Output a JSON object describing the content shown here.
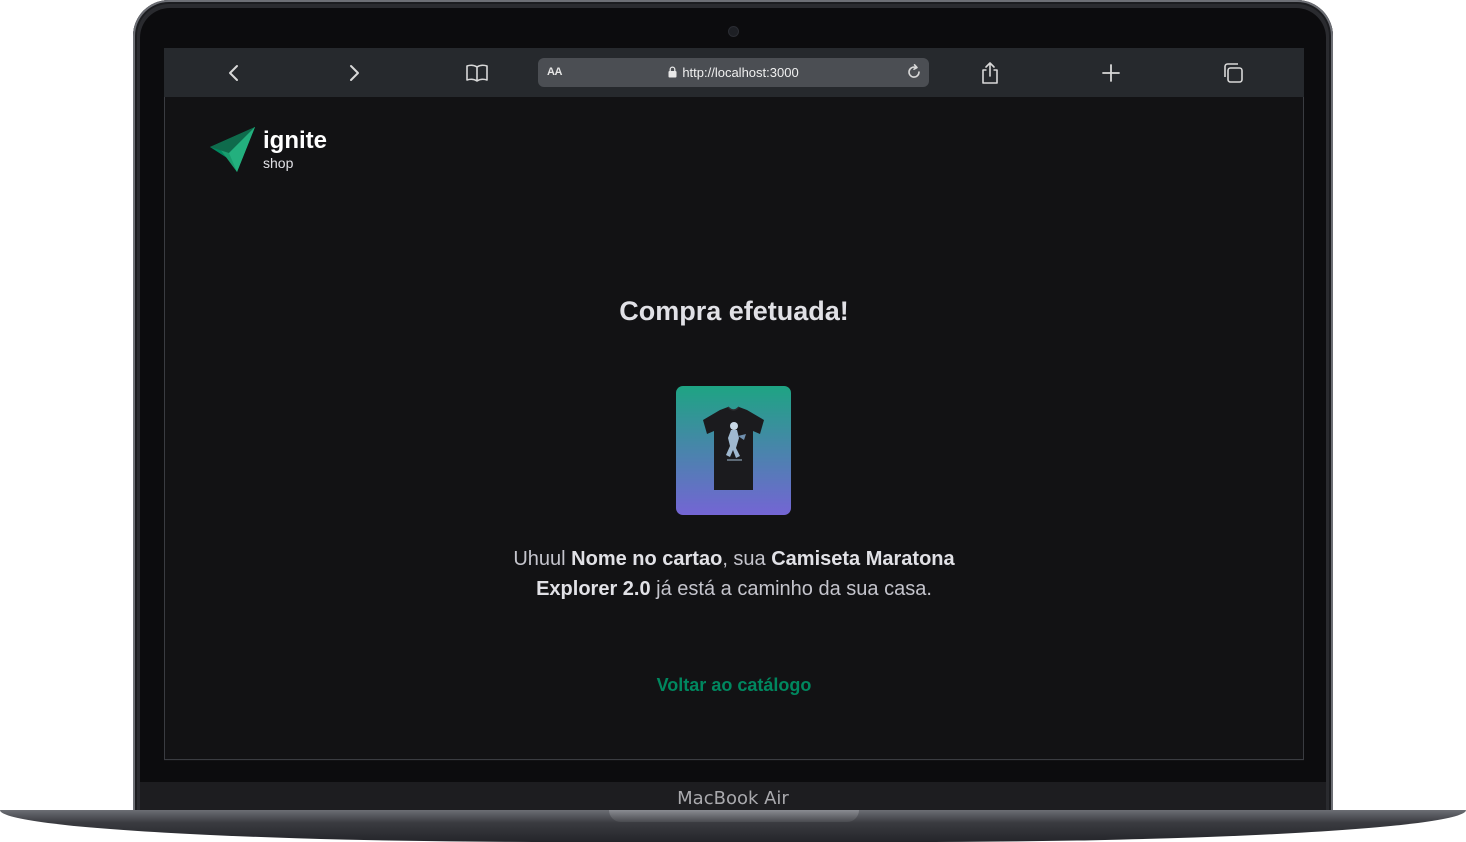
{
  "browser": {
    "url_aa": "AA",
    "url": "http://localhost:3000",
    "icons": [
      "back-icon",
      "forward-icon",
      "book-icon",
      "lock-icon",
      "reload-icon",
      "share-icon",
      "new-tab-icon",
      "tabs-icon"
    ]
  },
  "brand": {
    "title": "ignite",
    "subtitle": "shop",
    "accent": "#00875f"
  },
  "success": {
    "title": "Compra efetuada!",
    "message_prefix": "Uhuul ",
    "customer_name": "Nome no cartao",
    "message_mid": ", sua ",
    "product_name": "Camiseta Maratona Explorer 2.0",
    "message_suffix": " já está a caminho da sua casa.",
    "back_link": "Voltar ao catálogo"
  },
  "device": {
    "label": "MacBook Air"
  },
  "colors": {
    "background": "#121214",
    "card_gradient_top": "#1ea483",
    "card_gradient_bottom": "#7465d4"
  }
}
